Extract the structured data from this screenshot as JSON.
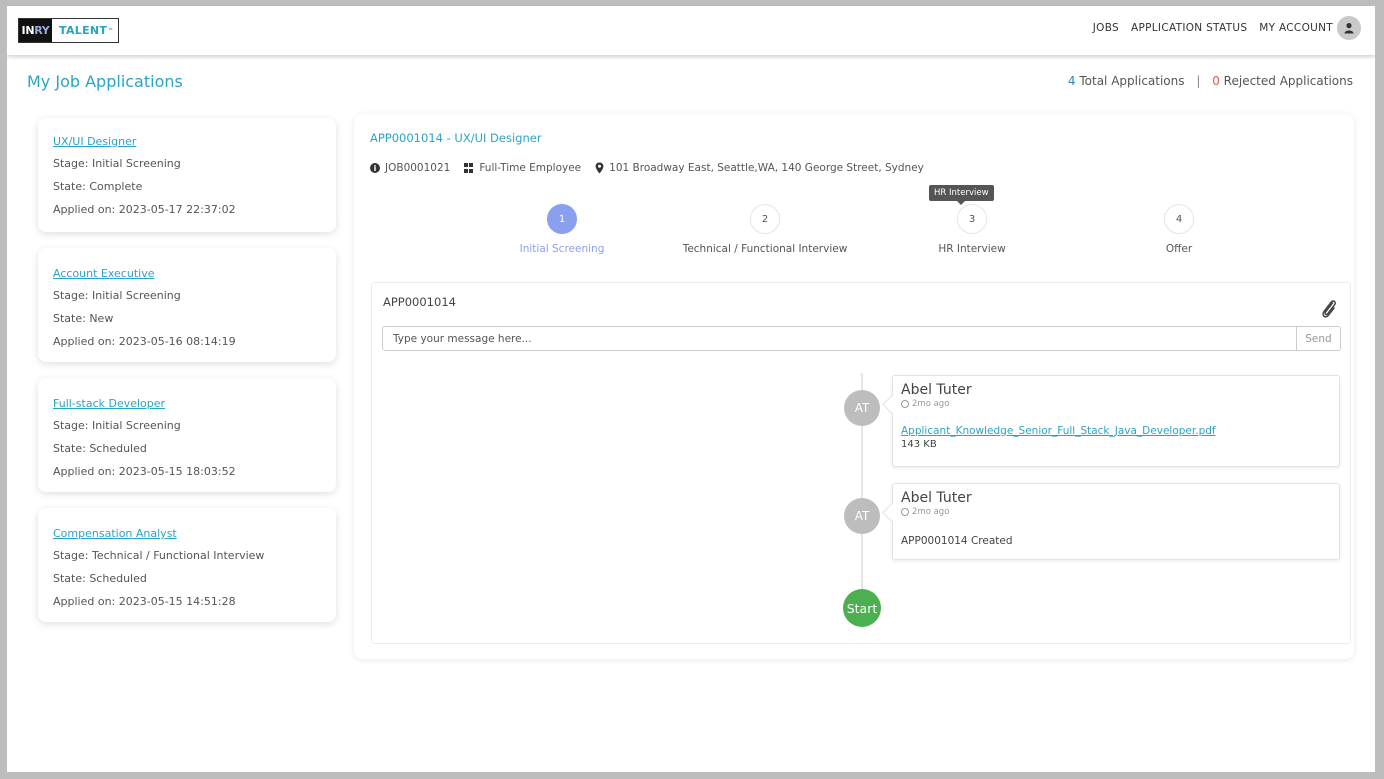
{
  "header": {
    "logo": {
      "part1_a": "IN",
      "part1_b": "RY",
      "part2": "TALENT",
      "tm": "™"
    },
    "nav": [
      {
        "label": "JOBS"
      },
      {
        "label": "APPLICATION STATUS"
      },
      {
        "label": "MY ACCOUNT"
      }
    ],
    "avatar_icon": "user-icon"
  },
  "page": {
    "title": "My Job Applications",
    "total_count": "4",
    "total_label": " Total Applications",
    "separator": "|",
    "rejected_count": "0",
    "rejected_label": " Rejected Applications",
    "colors": {
      "accent": "#29a4c5",
      "rejected": "#e05a4a",
      "step_active": "#8b9ff0",
      "start": "#4cb050"
    }
  },
  "applications": [
    {
      "title": "UX/UI Designer",
      "stage": "Stage: Initial Screening",
      "state": "State: Complete",
      "applied": "Applied on: 2023-05-17 22:37:02"
    },
    {
      "title": "Account Executive",
      "stage": "Stage: Initial Screening",
      "state": "State: New",
      "applied": "Applied on: 2023-05-16 08:14:19"
    },
    {
      "title": "Full-stack Developer",
      "stage": "Stage: Initial Screening",
      "state": "State: Scheduled",
      "applied": "Applied on: 2023-05-15 18:03:52"
    },
    {
      "title": "Compensation Analyst",
      "stage": "Stage: Technical / Functional Interview",
      "state": "State: Scheduled",
      "applied": "Applied on: 2023-05-15 14:51:28"
    }
  ],
  "detail": {
    "title": "APP0001014 - UX/UI Designer",
    "job_id": "JOB0001021",
    "job_type": "Full-Time Employee",
    "location": "101 Broadway East, Seattle,WA, 140 George Street, Sydney",
    "steps": [
      {
        "number": "1",
        "label": "Initial Screening",
        "active": true
      },
      {
        "number": "2",
        "label": "Technical / Functional Interview",
        "active": false
      },
      {
        "number": "3",
        "label": "HR Interview",
        "active": false
      },
      {
        "number": "4",
        "label": "Offer",
        "active": false
      }
    ],
    "tooltip": "HR Interview"
  },
  "chat": {
    "id": "APP0001014",
    "placeholder": "Type your message here...",
    "send_label": "Send",
    "attach_icon": "paperclip-icon",
    "entries": [
      {
        "initials": "AT",
        "name": "Abel Tuter",
        "time": "2mo ago",
        "attachment": "Applicant_Knowledge_Senior_Full_Stack_Java_Developer.pdf",
        "size": "143 KB"
      },
      {
        "initials": "AT",
        "name": "Abel Tuter",
        "time": "2mo ago",
        "text": "APP0001014 Created"
      }
    ],
    "start_label": "Start"
  }
}
